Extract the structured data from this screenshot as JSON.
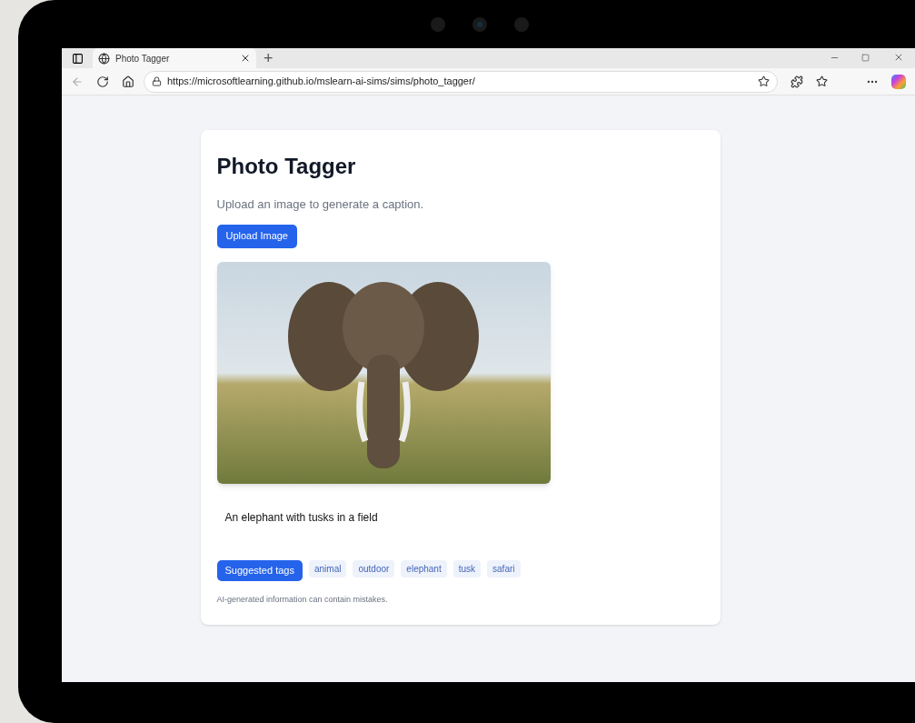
{
  "browser": {
    "tab_title": "Photo Tagger",
    "url": "https://microsoftlearning.github.io/mslearn-ai-sims/sims/photo_tagger/",
    "new_tab": "+"
  },
  "page": {
    "title": "Photo Tagger",
    "subtitle": "Upload an image to generate a caption.",
    "upload_button": "Upload Image",
    "caption": "An elephant with tusks in a field",
    "tags_button": "Suggested tags",
    "tags": [
      "animal",
      "outdoor",
      "elephant",
      "tusk",
      "safari"
    ],
    "disclaimer": "AI-generated information can contain mistakes."
  }
}
